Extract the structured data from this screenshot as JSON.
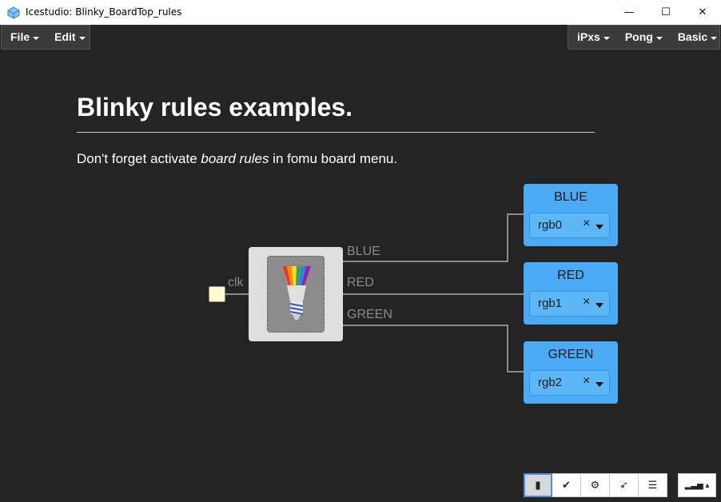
{
  "window": {
    "title": "Icestudio: Blinky_BoardTop_rules",
    "minimize_glyph": "—",
    "maximize_glyph": "☐",
    "close_glyph": "✕"
  },
  "menu": {
    "left": [
      {
        "label": "File"
      },
      {
        "label": "Edit"
      }
    ],
    "right": [
      {
        "label": "iPxs"
      },
      {
        "label": "Pong"
      },
      {
        "label": "Basic"
      }
    ]
  },
  "canvas": {
    "heading": "Blinky rules examples.",
    "note_before": "Don't forget activate ",
    "note_emphasis": "board rules",
    "note_after": " in fomu board menu.",
    "input_label": "clk",
    "block_outputs": [
      "BLUE",
      "RED",
      "GREEN"
    ],
    "outputs": [
      {
        "name": "BLUE",
        "pin": "rgb0"
      },
      {
        "name": "RED",
        "pin": "rgb1"
      },
      {
        "name": "GREEN",
        "pin": "rgb2"
      }
    ],
    "clear_glyph": "×"
  },
  "toolbar": {
    "buttons": [
      {
        "icon": "chip-icon",
        "glyph": "▮"
      },
      {
        "icon": "check-icon",
        "glyph": "✔"
      },
      {
        "icon": "gear-icon",
        "glyph": "⚙"
      },
      {
        "icon": "rocket-icon",
        "glyph": "➶"
      },
      {
        "icon": "align-left-icon",
        "glyph": "☰"
      },
      {
        "icon": "bar-chart-icon",
        "glyph": "▂▃▅ ▴"
      }
    ]
  },
  "colors": {
    "background": "#242424",
    "output_box": "#4aaaf5",
    "input_port": "#fefccf",
    "wire": "#8a8a8a"
  }
}
